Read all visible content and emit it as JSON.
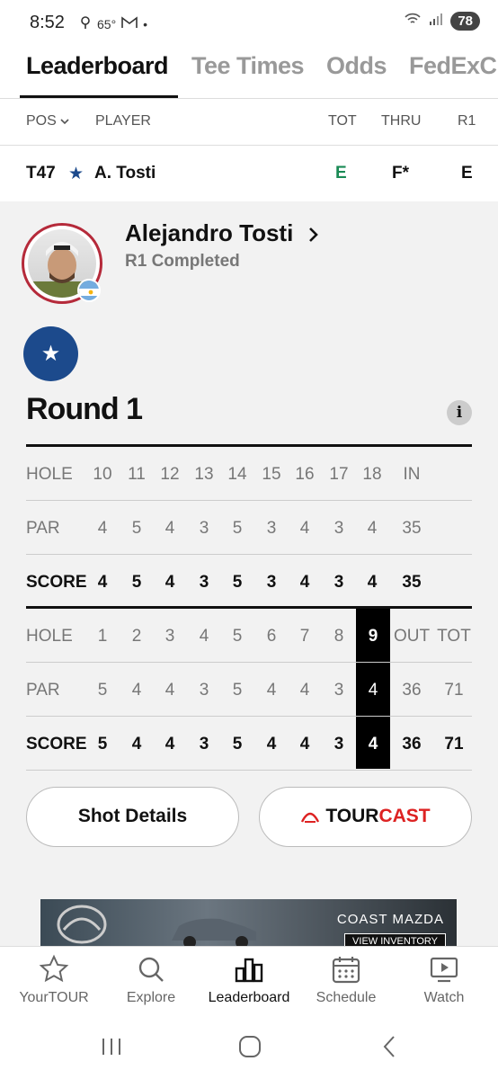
{
  "status_bar": {
    "time": "8:52",
    "temp": "65°",
    "battery": "78"
  },
  "tabs": [
    "Leaderboard",
    "Tee Times",
    "Odds",
    "FedExCup"
  ],
  "columns": {
    "pos": "POS",
    "player": "PLAYER",
    "tot": "TOT",
    "thru": "THRU",
    "r1": "R1"
  },
  "player_row": {
    "pos": "T47",
    "name": "A. Tosti",
    "tot": "E",
    "thru": "F*",
    "r1": "E"
  },
  "player": {
    "full_name": "Alejandro Tosti",
    "status": "R1 Completed"
  },
  "round": {
    "title": "Round 1"
  },
  "back_nine": {
    "hole": [
      "HOLE",
      "10",
      "11",
      "12",
      "13",
      "14",
      "15",
      "16",
      "17",
      "18",
      "IN"
    ],
    "par": [
      "PAR",
      "4",
      "5",
      "4",
      "3",
      "5",
      "3",
      "4",
      "3",
      "4",
      "35"
    ],
    "score": [
      "SCORE",
      "4",
      "5",
      "4",
      "3",
      "5",
      "3",
      "4",
      "3",
      "4",
      "35"
    ]
  },
  "front_nine": {
    "hole": [
      "HOLE",
      "1",
      "2",
      "3",
      "4",
      "5",
      "6",
      "7",
      "8",
      "9",
      "OUT",
      "TOT"
    ],
    "par": [
      "PAR",
      "5",
      "4",
      "4",
      "3",
      "5",
      "4",
      "4",
      "3",
      "4",
      "36",
      "71"
    ],
    "score": [
      "SCORE",
      "5",
      "4",
      "4",
      "3",
      "5",
      "4",
      "4",
      "3",
      "4",
      "36",
      "71"
    ]
  },
  "buttons": {
    "shot_details": "Shot Details",
    "tourcast_a": "TOUR",
    "tourcast_b": "CAST"
  },
  "ad": {
    "brand": "COAST MAZDA",
    "cta": "VIEW INVENTORY"
  },
  "bottom_nav": [
    "YourTOUR",
    "Explore",
    "Leaderboard",
    "Schedule",
    "Watch"
  ],
  "colors": {
    "accent_green": "#1a8a55",
    "star_blue": "#1c4a8c",
    "tourcast_red": "#dd2222"
  }
}
